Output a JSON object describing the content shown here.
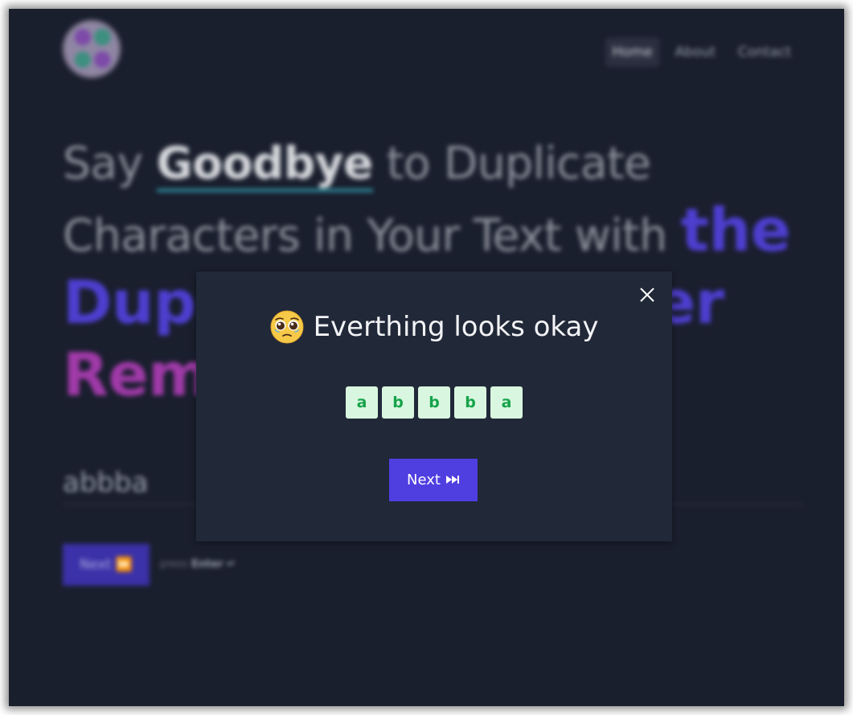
{
  "background_page": {
    "nav": [
      {
        "label": "Home"
      },
      {
        "label": "About"
      },
      {
        "label": "Contact"
      }
    ],
    "hero": {
      "part1": "Say ",
      "highlight": "Goodbye",
      "part2": " to Duplicate Characters in Your Text with ",
      "accent1": "the Duplicate Character",
      "accent2": "Remover"
    },
    "input_value": "abbba",
    "next_label": "Next ⏩",
    "hint_prefix": "press",
    "hint_key": "Enter ↵"
  },
  "modal": {
    "emoji_icon": "pleading-face-emoji",
    "title": "Everthing looks okay",
    "characters": [
      "a",
      "b",
      "b",
      "b",
      "a"
    ],
    "next_label": "Next",
    "next_icon": "fast-forward-icon",
    "close_icon": "close-icon"
  },
  "colors": {
    "modal_bg": "#212838",
    "page_bg": "#1a1f2e",
    "accent": "#4f3ee0",
    "char_bg": "#d9f7e0",
    "char_fg": "#16a34a"
  }
}
